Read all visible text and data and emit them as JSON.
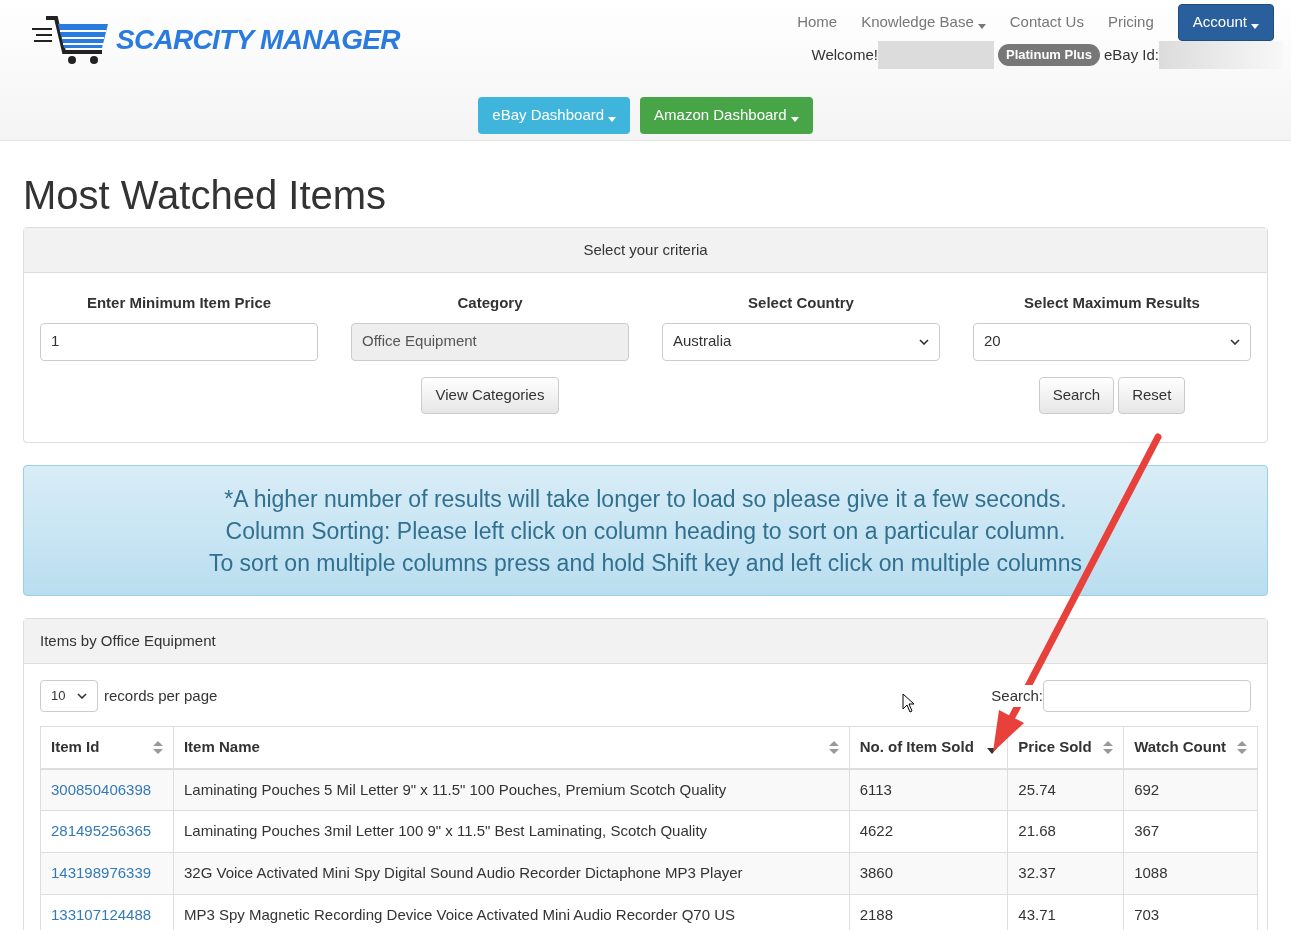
{
  "header": {
    "logo": "SCARCITY MANAGER",
    "nav": [
      {
        "label": "Home",
        "dropdown": false,
        "kind": "link"
      },
      {
        "label": "Knowledge Base",
        "dropdown": true,
        "kind": "link"
      },
      {
        "label": "Contact Us",
        "dropdown": false,
        "kind": "link"
      },
      {
        "label": "Pricing",
        "dropdown": false,
        "kind": "link"
      },
      {
        "label": "Account",
        "dropdown": true,
        "kind": "button"
      }
    ],
    "welcome": "Welcome!",
    "plan_badge": "Platinum Plus",
    "ebay_id_label": "eBay Id:",
    "dashboards": [
      {
        "label": "eBay Dashboard",
        "color": "#3fb5dc"
      },
      {
        "label": "Amazon Dashboard",
        "color": "#47a447"
      }
    ]
  },
  "page_title": "Most Watched Items",
  "criteria": {
    "title": "Select your criteria",
    "fields": [
      {
        "label": "Enter Minimum Item Price",
        "kind": "input",
        "value": "1",
        "disabled": false
      },
      {
        "label": "Category",
        "kind": "input",
        "value": "Office Equipment",
        "disabled": true
      },
      {
        "label": "Select Country",
        "kind": "select",
        "value": "Australia",
        "disabled": false
      },
      {
        "label": "Select Maximum Results",
        "kind": "select",
        "value": "20",
        "disabled": false
      }
    ],
    "view_button": "View Categories",
    "action_buttons": [
      "Search",
      "Reset"
    ]
  },
  "notice": [
    "*A higher number of results will take longer to load so please give it a few seconds.",
    "Column Sorting: Please left click on column heading to sort on a particular column.",
    "To sort on multiple columns press and hold Shift key and left click on multiple columns"
  ],
  "results": {
    "title": "Items by Office Equipment",
    "page_size": "10",
    "page_size_label": "records per page",
    "search_label": "Search:",
    "columns": [
      {
        "label": "Item Id",
        "sorted": false
      },
      {
        "label": "Item Name",
        "sorted": false
      },
      {
        "label": "No. of Item Sold",
        "sorted": true
      },
      {
        "label": "Price Sold",
        "sorted": false
      },
      {
        "label": "Watch Count",
        "sorted": false
      }
    ],
    "rows": [
      [
        "300850406398",
        "Laminating Pouches 5 Mil Letter 9\" x 11.5\" 100 Pouches, Premium Scotch Quality",
        "6113",
        "25.74",
        "692"
      ],
      [
        "281495256365",
        "Laminating Pouches 3mil Letter 100 9\" x 11.5\" Best Laminating, Scotch Quality",
        "4622",
        "21.68",
        "367"
      ],
      [
        "143198976339",
        "32G Voice Activated Mini Spy Digital Sound Audio Recorder Dictaphone MP3 Player",
        "3860",
        "32.37",
        "1088"
      ],
      [
        "133107124488",
        "MP3 Spy Magnetic Recording Device Voice Activated Mini Audio Recorder Q70 US",
        "2188",
        "43.71",
        "703"
      ]
    ]
  }
}
